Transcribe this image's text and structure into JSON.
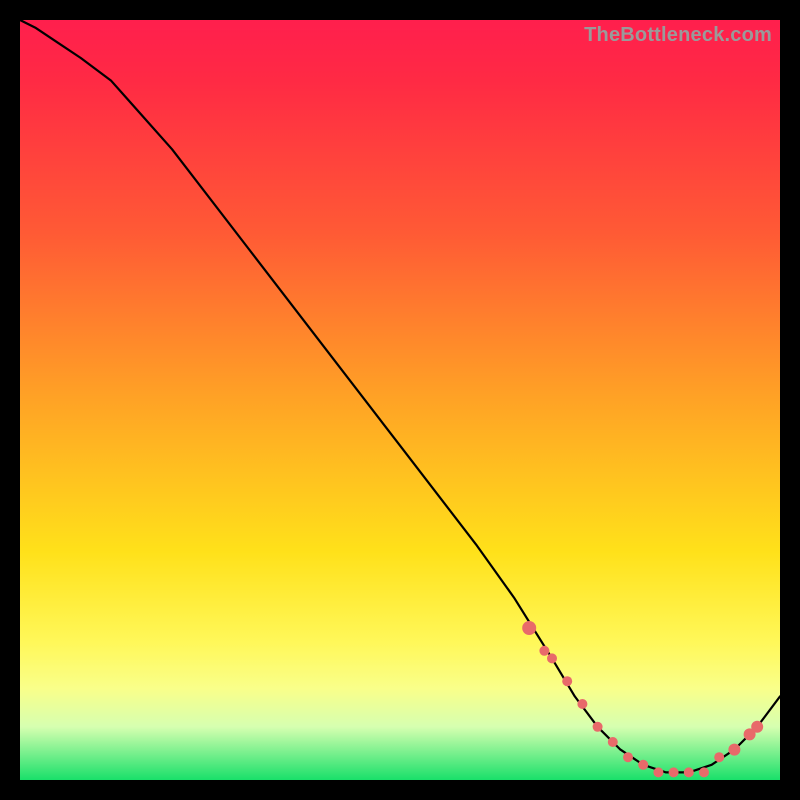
{
  "watermark": "TheBottleneck.com",
  "colors": {
    "background": "#000000",
    "curve": "#000000",
    "marker": "#e86a6a",
    "gradient_stops": [
      "#ff1f4d",
      "#ff2a44",
      "#ff5a35",
      "#ffa325",
      "#ffe11a",
      "#fff85a",
      "#f9ff8a",
      "#d6ffb0",
      "#19e06a"
    ]
  },
  "chart_data": {
    "type": "line",
    "title": "",
    "xlabel": "",
    "ylabel": "",
    "xlim": [
      0,
      100
    ],
    "ylim": [
      0,
      100
    ],
    "series": [
      {
        "name": "bottleneck-curve",
        "x": [
          0,
          2,
          5,
          8,
          12,
          20,
          30,
          40,
          50,
          60,
          65,
          70,
          73,
          76,
          79,
          82,
          85,
          88,
          91,
          94,
          97,
          100
        ],
        "y": [
          100,
          99,
          97,
          95,
          92,
          83,
          70,
          57,
          44,
          31,
          24,
          16,
          11,
          7,
          4,
          2,
          1,
          1,
          2,
          4,
          7,
          11
        ]
      },
      {
        "name": "highlight-markers",
        "x": [
          67,
          69,
          70,
          72,
          74,
          76,
          78,
          80,
          82,
          84,
          86,
          88,
          90,
          92,
          94,
          96,
          97
        ],
        "y": [
          20,
          17,
          16,
          13,
          10,
          7,
          5,
          3,
          2,
          1,
          1,
          1,
          1,
          3,
          4,
          6,
          7
        ]
      }
    ]
  }
}
